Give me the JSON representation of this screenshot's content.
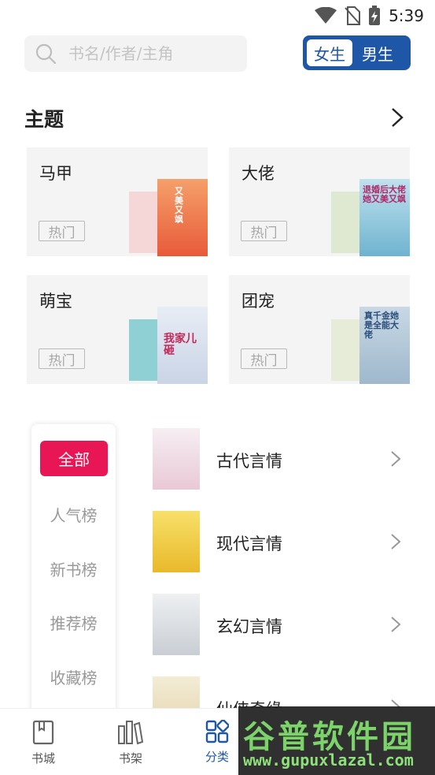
{
  "status": {
    "time": "5:39",
    "icons": [
      "wifi-icon",
      "no-sim-icon",
      "battery-charging-icon"
    ]
  },
  "search": {
    "placeholder": "书名/作者/主角"
  },
  "gender": {
    "active": "女生",
    "inactive": "男生"
  },
  "topics": {
    "title": "主题",
    "cards": [
      {
        "title": "马甲",
        "badge": "热门",
        "cover_text": "又美又飒",
        "cover_color": "#f07a4a"
      },
      {
        "title": "大佬",
        "badge": "热门",
        "cover_text": "退婚后大佬她又美又飒",
        "cover_color": "#7cc2d8"
      },
      {
        "title": "萌宝",
        "badge": "热门",
        "cover_text": "我家儿砸",
        "cover_color": "#cfd8e6"
      },
      {
        "title": "团宠",
        "badge": "热门",
        "cover_text": "真千金她是全能大佬",
        "cover_color": "#aac3d6"
      }
    ]
  },
  "ranking": {
    "tabs": [
      "全部",
      "人气榜",
      "新书榜",
      "推荐榜",
      "收藏榜"
    ],
    "active": "全部"
  },
  "categories": [
    {
      "name": "古代言情",
      "cover_color": "#f2e4ea"
    },
    {
      "name": "现代言情",
      "cover_color": "#f3d33a"
    },
    {
      "name": "玄幻言情",
      "cover_color": "#e9ecef"
    },
    {
      "name": "仙侠奇缘",
      "cover_color": "#efe6cf"
    }
  ],
  "bottom_nav": {
    "items": [
      {
        "label": "书城",
        "icon": "bookstore-icon"
      },
      {
        "label": "书架",
        "icon": "bookshelf-icon"
      },
      {
        "label": "分类",
        "icon": "category-icon",
        "active": true
      }
    ]
  },
  "watermark": {
    "logo": "谷普软件园",
    "url": "www.gupuxlazal.com"
  },
  "colors": {
    "brand_blue": "#1e57a8",
    "accent_pink": "#e91656"
  }
}
